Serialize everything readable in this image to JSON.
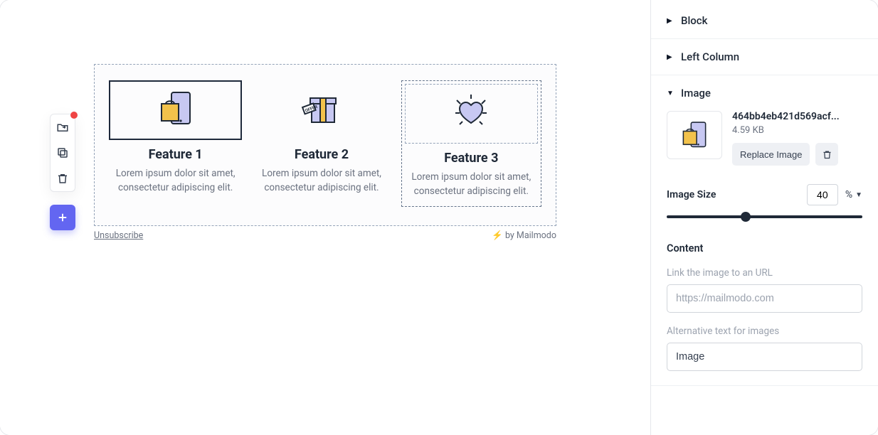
{
  "toolbar": {
    "has_notification": true
  },
  "block": {
    "columns": [
      {
        "title": "Feature 1",
        "desc": "Lorem ipsum dolor sit amet, consectetur adipiscing elit.",
        "icon": "shopping-bag-phone",
        "image_active": true
      },
      {
        "title": "Feature 2",
        "desc": "Lorem ipsum dolor sit amet, consectetur adipiscing elit.",
        "icon": "gift-offer",
        "image_active": false
      },
      {
        "title": "Feature 3",
        "desc": "Lorem ipsum dolor sit amet, consectetur adipiscing elit.",
        "icon": "heart-shine",
        "image_active": false,
        "column_selected": true
      }
    ]
  },
  "footer": {
    "unsubscribe": "Unsubscribe",
    "branding": "⚡ by Mailmodo"
  },
  "sidebar": {
    "sections": {
      "block": {
        "label": "Block",
        "open": false
      },
      "left_column": {
        "label": "Left Column",
        "open": false
      },
      "image": {
        "label": "Image",
        "open": true
      }
    },
    "image_panel": {
      "filename": "464bb4eb421d569acf...",
      "filesize": "4.59 KB",
      "replace_label": "Replace Image",
      "size_label": "Image Size",
      "size_value": "40",
      "size_unit": "%",
      "content_label": "Content",
      "link_label": "Link the image to an URL",
      "link_placeholder": "https://mailmodo.com",
      "link_value": "",
      "alt_label": "Alternative text for images",
      "alt_value": "Image"
    }
  }
}
